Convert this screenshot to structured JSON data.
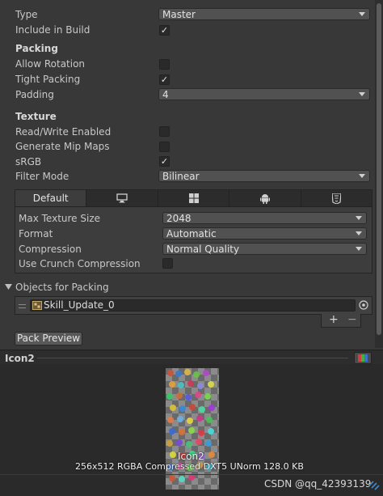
{
  "settings": {
    "type_label": "Type",
    "type_value": "Master",
    "include_label": "Include in Build",
    "include_checked": true
  },
  "packing": {
    "header": "Packing",
    "allow_rotation_label": "Allow Rotation",
    "allow_rotation_checked": false,
    "tight_packing_label": "Tight Packing",
    "tight_packing_checked": true,
    "padding_label": "Padding",
    "padding_value": "4"
  },
  "texture": {
    "header": "Texture",
    "readwrite_label": "Read/Write Enabled",
    "readwrite_checked": false,
    "mipmaps_label": "Generate Mip Maps",
    "mipmaps_checked": false,
    "srgb_label": "sRGB",
    "srgb_checked": true,
    "filter_label": "Filter Mode",
    "filter_value": "Bilinear"
  },
  "platform": {
    "tabs": [
      {
        "label": "Default",
        "icon": "default"
      },
      {
        "label": "",
        "icon": "monitor-icon"
      },
      {
        "label": "",
        "icon": "windows-icon"
      },
      {
        "label": "",
        "icon": "android-icon"
      },
      {
        "label": "",
        "icon": "html5-icon"
      }
    ],
    "max_size_label": "Max Texture Size",
    "max_size_value": "2048",
    "format_label": "Format",
    "format_value": "Automatic",
    "compression_label": "Compression",
    "compression_value": "Normal Quality",
    "crunch_label": "Use Crunch Compression",
    "crunch_checked": false
  },
  "objects": {
    "header": "Objects for Packing",
    "items": [
      {
        "name": "Skill_Update_0"
      }
    ],
    "add_label": "+",
    "remove_label": "−"
  },
  "pack_preview_label": "Pack Preview",
  "preview": {
    "title": "Icon2",
    "image_label": "Icon2",
    "info": "256x512 RGBA Compressed DXT5 UNorm   128.0 KB"
  },
  "watermark": "CSDN @qq_42393139",
  "colors": {
    "background": "#383838",
    "field": "#515151",
    "preview_bg": "#2a2a2a"
  }
}
